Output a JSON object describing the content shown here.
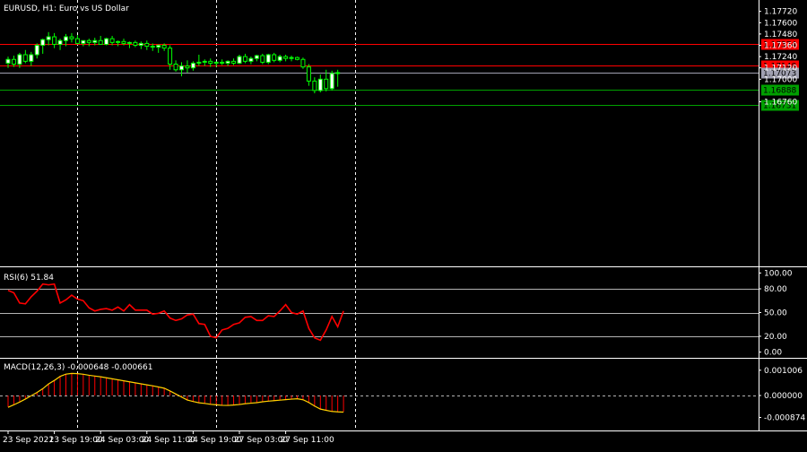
{
  "header": {
    "symbol_label": "EURUSD, H1:  Euro vs US Dollar"
  },
  "colors": {
    "background": "#000000",
    "grid": "#ffffff",
    "axis": "#ffffff",
    "text": "#ffffff",
    "bull": "#ffffff",
    "bear": "#000000",
    "wick": "#00ff00",
    "red_line": "#ff0000",
    "green_line": "#00a000",
    "gray_line": "#a0a0b0",
    "rsi_line": "#ff0000",
    "macd_hist": "#ff0000",
    "macd_signal": "#ffd000"
  },
  "time_axis": {
    "labels": [
      "23 Sep 2021",
      "23 Sep 19:00",
      "24 Sep 03:00",
      "24 Sep 11:00",
      "24 Sep 19:00",
      "27 Sep 03:00",
      "27 Sep 11:00"
    ],
    "label_bars": [
      0,
      8,
      16,
      24,
      32,
      40,
      48
    ],
    "separator_bars": [
      12,
      36,
      60
    ]
  },
  "price_panel": {
    "y_range": [
      1.1664,
      1.178
    ],
    "tick_labels": [
      "1.17720",
      "1.17600",
      "1.17480",
      "1.17360",
      "1.17240",
      "1.17120",
      "1.17000",
      "1.16760"
    ],
    "tick_values": [
      1.1772,
      1.176,
      1.1748,
      1.1736,
      1.1724,
      1.1712,
      1.17,
      1.1676
    ],
    "levels": [
      {
        "label": "1.17374",
        "value": 1.17374,
        "kind": "red"
      },
      {
        "label": "1.17148",
        "value": 1.17148,
        "kind": "red"
      },
      {
        "label": "1.17073",
        "value": 1.17073,
        "kind": "gray"
      },
      {
        "label": "1.16888",
        "value": 1.16888,
        "kind": "green"
      },
      {
        "label": "1.16731",
        "value": 1.16731,
        "kind": "green"
      }
    ]
  },
  "rsi_panel": {
    "title": "RSI(6) 51.84",
    "tick_labels": [
      "100.00",
      "80.00",
      "50.00",
      "20.00",
      "0.00"
    ],
    "tick_values": [
      100,
      80,
      50,
      20,
      0
    ],
    "level_values": [
      80,
      50,
      20
    ]
  },
  "macd_panel": {
    "title": "MACD(12,26,3) -0.000648 -0.000661",
    "tick_labels": [
      "0.001006",
      "0.000000",
      "-0.000874"
    ],
    "tick_values": [
      0.001006,
      0,
      -0.000874
    ]
  },
  "chart_data": {
    "type": "candlestick",
    "symbol": "EURUSD",
    "timeframe": "H1",
    "candles": [
      [
        1.1717,
        1.1724,
        1.1712,
        1.1721
      ],
      [
        1.1721,
        1.1725,
        1.1713,
        1.1716
      ],
      [
        1.1716,
        1.1728,
        1.1712,
        1.1726
      ],
      [
        1.1726,
        1.1731,
        1.1717,
        1.1719
      ],
      [
        1.1719,
        1.1729,
        1.1714,
        1.1726
      ],
      [
        1.1726,
        1.1738,
        1.1722,
        1.1736
      ],
      [
        1.1736,
        1.1743,
        1.1727,
        1.1742
      ],
      [
        1.1742,
        1.175,
        1.1736,
        1.1745
      ],
      [
        1.1745,
        1.1749,
        1.1733,
        1.1737
      ],
      [
        1.1737,
        1.1743,
        1.1731,
        1.1741
      ],
      [
        1.1741,
        1.1748,
        1.1735,
        1.1745
      ],
      [
        1.1745,
        1.1749,
        1.1739,
        1.1743
      ],
      [
        1.1743,
        1.1747,
        1.1737,
        1.1738
      ],
      [
        1.1738,
        1.174,
        1.1735,
        1.1741
      ],
      [
        1.1741,
        1.1743,
        1.1735,
        1.1739
      ],
      [
        1.1739,
        1.1744,
        1.1736,
        1.1741
      ],
      [
        1.1741,
        1.1746,
        1.1738,
        1.1737
      ],
      [
        1.1737,
        1.1744,
        1.1736,
        1.1743
      ],
      [
        1.1743,
        1.1746,
        1.1736,
        1.1739
      ],
      [
        1.1739,
        1.1741,
        1.1735,
        1.174
      ],
      [
        1.174,
        1.1743,
        1.1736,
        1.1738
      ],
      [
        1.1738,
        1.174,
        1.1733,
        1.1739
      ],
      [
        1.1739,
        1.1741,
        1.1734,
        1.1736
      ],
      [
        1.1736,
        1.174,
        1.1732,
        1.1738
      ],
      [
        1.1738,
        1.1741,
        1.1731,
        1.1735
      ],
      [
        1.1735,
        1.1738,
        1.173,
        1.1734
      ],
      [
        1.1734,
        1.1737,
        1.1728,
        1.1736
      ],
      [
        1.1736,
        1.1738,
        1.173,
        1.1733
      ],
      [
        1.1733,
        1.1736,
        1.171,
        1.1716
      ],
      [
        1.1716,
        1.172,
        1.1708,
        1.171
      ],
      [
        1.171,
        1.1718,
        1.1703,
        1.1714
      ],
      [
        1.1714,
        1.172,
        1.1707,
        1.1712
      ],
      [
        1.1712,
        1.1719,
        1.1709,
        1.1717
      ],
      [
        1.1717,
        1.1726,
        1.1714,
        1.1718
      ],
      [
        1.1718,
        1.1721,
        1.1714,
        1.1719
      ],
      [
        1.1719,
        1.1722,
        1.1713,
        1.1717
      ],
      [
        1.1717,
        1.1719,
        1.1713,
        1.1718
      ],
      [
        1.1718,
        1.1721,
        1.1715,
        1.1717
      ],
      [
        1.1717,
        1.172,
        1.1714,
        1.1719
      ],
      [
        1.1719,
        1.1722,
        1.1715,
        1.1717
      ],
      [
        1.1717,
        1.1726,
        1.1716,
        1.1724
      ],
      [
        1.1724,
        1.1727,
        1.1717,
        1.1719
      ],
      [
        1.1719,
        1.1724,
        1.1716,
        1.1722
      ],
      [
        1.1722,
        1.1726,
        1.1719,
        1.1725
      ],
      [
        1.1725,
        1.1727,
        1.1716,
        1.1718
      ],
      [
        1.1718,
        1.1727,
        1.1716,
        1.1726
      ],
      [
        1.1726,
        1.1728,
        1.1718,
        1.172
      ],
      [
        1.172,
        1.1726,
        1.1718,
        1.1724
      ],
      [
        1.1724,
        1.1726,
        1.1719,
        1.1722
      ],
      [
        1.1722,
        1.1725,
        1.1719,
        1.1723
      ],
      [
        1.1723,
        1.1724,
        1.172,
        1.1721
      ],
      [
        1.1721,
        1.1723,
        1.1711,
        1.1713
      ],
      [
        1.1713,
        1.1716,
        1.1693,
        1.1698
      ],
      [
        1.1698,
        1.1702,
        1.1685,
        1.1688
      ],
      [
        1.1688,
        1.1705,
        1.1686,
        1.17
      ],
      [
        1.17,
        1.171,
        1.1687,
        1.169
      ],
      [
        1.169,
        1.1709,
        1.1688,
        1.1706
      ],
      [
        1.1706,
        1.171,
        1.1692,
        1.1707
      ]
    ],
    "rsi": [
      78,
      75,
      62,
      61,
      70,
      77,
      86,
      85,
      86,
      62,
      66,
      72,
      67,
      65,
      56,
      52,
      54,
      55,
      53,
      57,
      52,
      60,
      53,
      53,
      53,
      48,
      49,
      52,
      43,
      40,
      42,
      47,
      48,
      36,
      35,
      20,
      18,
      28,
      30,
      35,
      37,
      44,
      45,
      40,
      40,
      46,
      45,
      52,
      60,
      50,
      48,
      52,
      30,
      18,
      15,
      28,
      45,
      32,
      52
    ],
    "macd_hist": [
      -0.00045,
      -0.00035,
      -0.00024,
      -0.00012,
      0.0,
      0.00012,
      0.00028,
      0.00048,
      0.00062,
      0.00078,
      0.00086,
      0.00088,
      0.00087,
      0.00084,
      0.0008,
      0.00077,
      0.00074,
      0.0007,
      0.00066,
      0.00062,
      0.00058,
      0.00054,
      0.0005,
      0.00046,
      0.00042,
      0.00038,
      0.00033,
      0.00028,
      0.00016,
      4e-05,
      -8e-05,
      -0.0002,
      -0.00026,
      -0.0003,
      -0.00032,
      -0.00036,
      -0.00038,
      -0.0004,
      -0.0004,
      -0.00038,
      -0.00036,
      -0.00032,
      -0.0003,
      -0.00028,
      -0.00024,
      -0.00022,
      -0.0002,
      -0.00018,
      -0.00016,
      -0.00014,
      -0.00012,
      -0.00018,
      -0.0003,
      -0.00045,
      -0.00056,
      -0.0006,
      -0.00064,
      -0.00065,
      -0.000648
    ],
    "macd_signal": [
      -0.00047,
      -0.00037,
      -0.00026,
      -0.00014,
      -1e-05,
      0.00012,
      0.00027,
      0.00046,
      0.0006,
      0.00076,
      0.00085,
      0.00088,
      0.00087,
      0.000845,
      0.000805,
      0.000775,
      0.000745,
      0.000705,
      0.000665,
      0.000625,
      0.000585,
      0.000545,
      0.000505,
      0.000465,
      0.000425,
      0.000385,
      0.00034,
      0.00029,
      0.00018,
      6e-05,
      -6e-05,
      -0.00018,
      -0.00024,
      -0.00029,
      -0.000315,
      -0.00035,
      -0.00037,
      -0.00039,
      -0.000395,
      -0.00038,
      -0.00036,
      -0.000325,
      -0.000305,
      -0.000285,
      -0.00025,
      -0.000225,
      -0.000205,
      -0.000185,
      -0.000165,
      -0.000145,
      -0.00013,
      -0.00017,
      -0.00028,
      -0.00042,
      -0.00054,
      -0.00059,
      -0.000635,
      -0.000652,
      -0.000661
    ]
  }
}
